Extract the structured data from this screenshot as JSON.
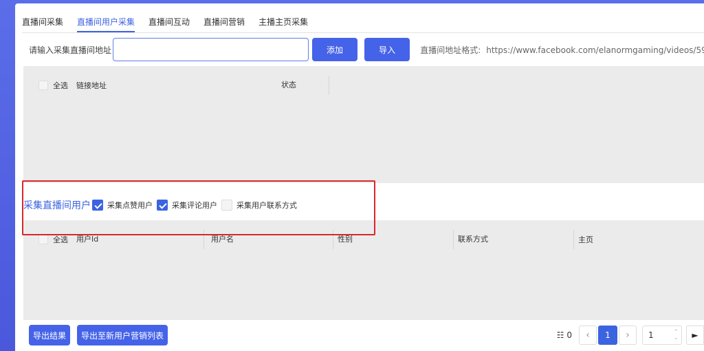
{
  "tabs": [
    {
      "label": "直播间采集"
    },
    {
      "label": "直播间用户采集"
    },
    {
      "label": "直播间互动"
    },
    {
      "label": "直播间营销"
    },
    {
      "label": "主播主页采集"
    }
  ],
  "input_row": {
    "label": "请输入采集直播间地址",
    "value": "",
    "add_label": "添加",
    "import_label": "导入",
    "hint_label": "直播间地址格式:",
    "hint_example": "https://www.facebook.com/elanormgaming/videos/59"
  },
  "table1": {
    "select_all": "全选",
    "columns": [
      "链接地址",
      "状态"
    ]
  },
  "section2": {
    "title": "采集直播间用户",
    "options": [
      {
        "label": "采集点赞用户",
        "checked": true
      },
      {
        "label": "采集评论用户",
        "checked": true
      },
      {
        "label": "采集用户联系方式",
        "checked": false
      }
    ]
  },
  "table2": {
    "select_all": "全选",
    "columns": [
      "用户Id",
      "用户名",
      "性别",
      "联系方式",
      "主页"
    ]
  },
  "bottom": {
    "export_label": "导出结果",
    "export_new_label": "导出至新用户营销列表"
  },
  "pager": {
    "count_icon": "☷",
    "count": "0",
    "current_page": "1",
    "jump_value": "1",
    "go_label": "►"
  },
  "colors": {
    "accent": "#3c63e0",
    "button": "#4563e8",
    "highlight": "#d9252b",
    "background": "#4a58dc"
  }
}
